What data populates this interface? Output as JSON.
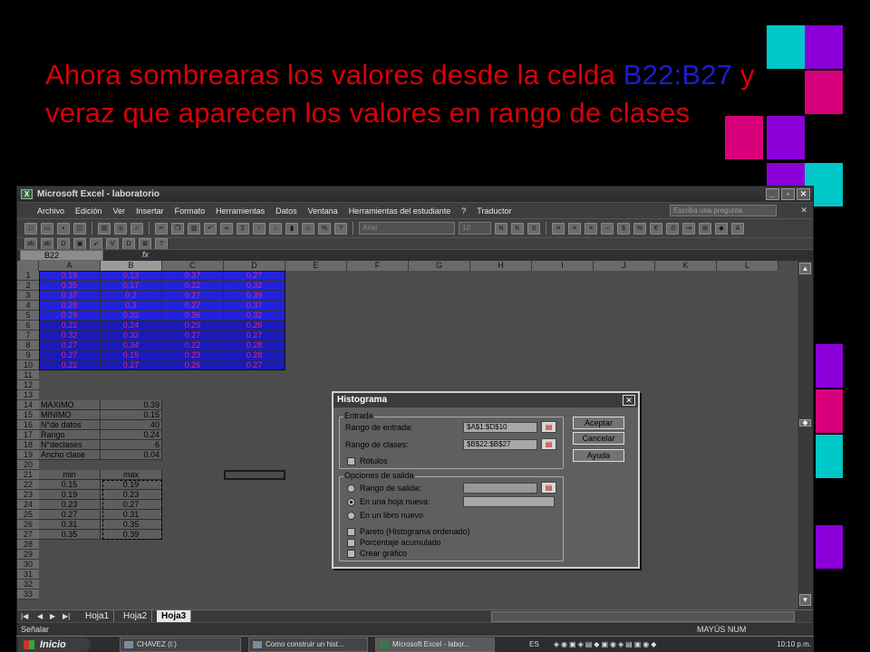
{
  "slide": {
    "title_part1": "Ahora sombrearas los valores desde la celda ",
    "title_range": "B22:B27",
    "title_part2": " y veraz que aparecen los valores en rango de clases"
  },
  "colors": {
    "red_text": "#d8000a",
    "blue_text": "#1d1dd0",
    "cyan": "#00c8c8",
    "purple": "#8b00d8",
    "magenta": "#d8007a"
  },
  "window": {
    "title": "Microsoft Excel - laboratorio",
    "menu": [
      "Archivo",
      "Edición",
      "Ver",
      "Insertar",
      "Formato",
      "Herramientas",
      "Datos",
      "Ventana",
      "Herramientas del estudiante",
      "?",
      "Traductor"
    ],
    "help_placeholder": "Escriba una pregunta",
    "font_name": "Arial",
    "font_size": "10",
    "name_box": "B22",
    "fx": "fx"
  },
  "grid": {
    "columns": [
      "A",
      "B",
      "C",
      "D",
      "E",
      "F",
      "G",
      "H",
      "I",
      "J",
      "K",
      "L"
    ],
    "rows": [
      "1",
      "2",
      "3",
      "4",
      "5",
      "6",
      "7",
      "8",
      "9",
      "10",
      "11",
      "12",
      "13",
      "14",
      "15",
      "16",
      "17",
      "18",
      "19",
      "20",
      "21",
      "22",
      "23",
      "24",
      "25",
      "26",
      "27",
      "28",
      "29",
      "30",
      "31",
      "32",
      "33"
    ],
    "data": [
      [
        "0.19",
        "0.13",
        "0.37",
        "0.27"
      ],
      [
        "0.35",
        "0.17",
        "0.22",
        "0.32"
      ],
      [
        "0.37",
        "0.2",
        "0.27",
        "0.39"
      ],
      [
        "0.28",
        "0.3",
        "0.27",
        "0.37"
      ],
      [
        "0.29",
        "0.32",
        "0.36",
        "0.32"
      ],
      [
        "0.22",
        "0.24",
        "0.29",
        "0.26"
      ],
      [
        "0.32",
        "0.32",
        "0.27",
        "0.27"
      ],
      [
        "0.27",
        "0.34",
        "0.22",
        "0.28"
      ],
      [
        "0.27",
        "0.15",
        "0.23",
        "0.28"
      ],
      [
        "0.22",
        "0.27",
        "0.26",
        "0.27"
      ]
    ],
    "stats": [
      {
        "label": "MAXIMO",
        "value": "0.39"
      },
      {
        "label": "MINIMO",
        "value": "0.15"
      },
      {
        "label": "N°de datos",
        "value": "40"
      },
      {
        "label": "Rango",
        "value": "0.24"
      },
      {
        "label": "N°declases",
        "value": "6"
      },
      {
        "label": "Ancho clase",
        "value": "0.04"
      }
    ],
    "class_header": {
      "min": "min",
      "max": "max"
    },
    "classes": [
      {
        "min": "0.15",
        "max": "0.19"
      },
      {
        "min": "0.19",
        "max": "0.23"
      },
      {
        "min": "0.23",
        "max": "0.27"
      },
      {
        "min": "0.27",
        "max": "0.31"
      },
      {
        "min": "0.31",
        "max": "0.35"
      },
      {
        "min": "0.35",
        "max": "0.39"
      }
    ]
  },
  "sheets": {
    "tabs": [
      "Hoja1",
      "Hoja2",
      "Hoja3"
    ],
    "active": "Hoja3"
  },
  "status": {
    "left": "Señalar",
    "right": "MAYÚS  NUM"
  },
  "dialog": {
    "title": "Histograma",
    "input_group": "Entrada",
    "input_range_label": "Rango de entrada:",
    "input_range_value": "$A$1:$D$10",
    "bin_range_label": "Rango de clases:",
    "bin_range_value": "$B$22:$B$27",
    "labels_checkbox": "Rótulos",
    "output_group": "Opciones de salida",
    "output_range_label": "Rango de salida:",
    "new_sheet_label": "En una hoja nueva:",
    "new_book_label": "En un libro nuevo",
    "pareto_label": "Pareto (Histograma ordenado)",
    "cumulative_label": "Porcentaje acumulado",
    "chart_label": "Crear gráfico",
    "ok": "Aceptar",
    "cancel": "Cancelar",
    "help": "Ayuda"
  },
  "taskbar": {
    "start": "Inicio",
    "tasks": [
      "CHAVEZ (I:)",
      "Como construir un hist...",
      "Microsoft Excel - labor..."
    ],
    "lang": "ES",
    "clock": "10:10 p.m."
  }
}
